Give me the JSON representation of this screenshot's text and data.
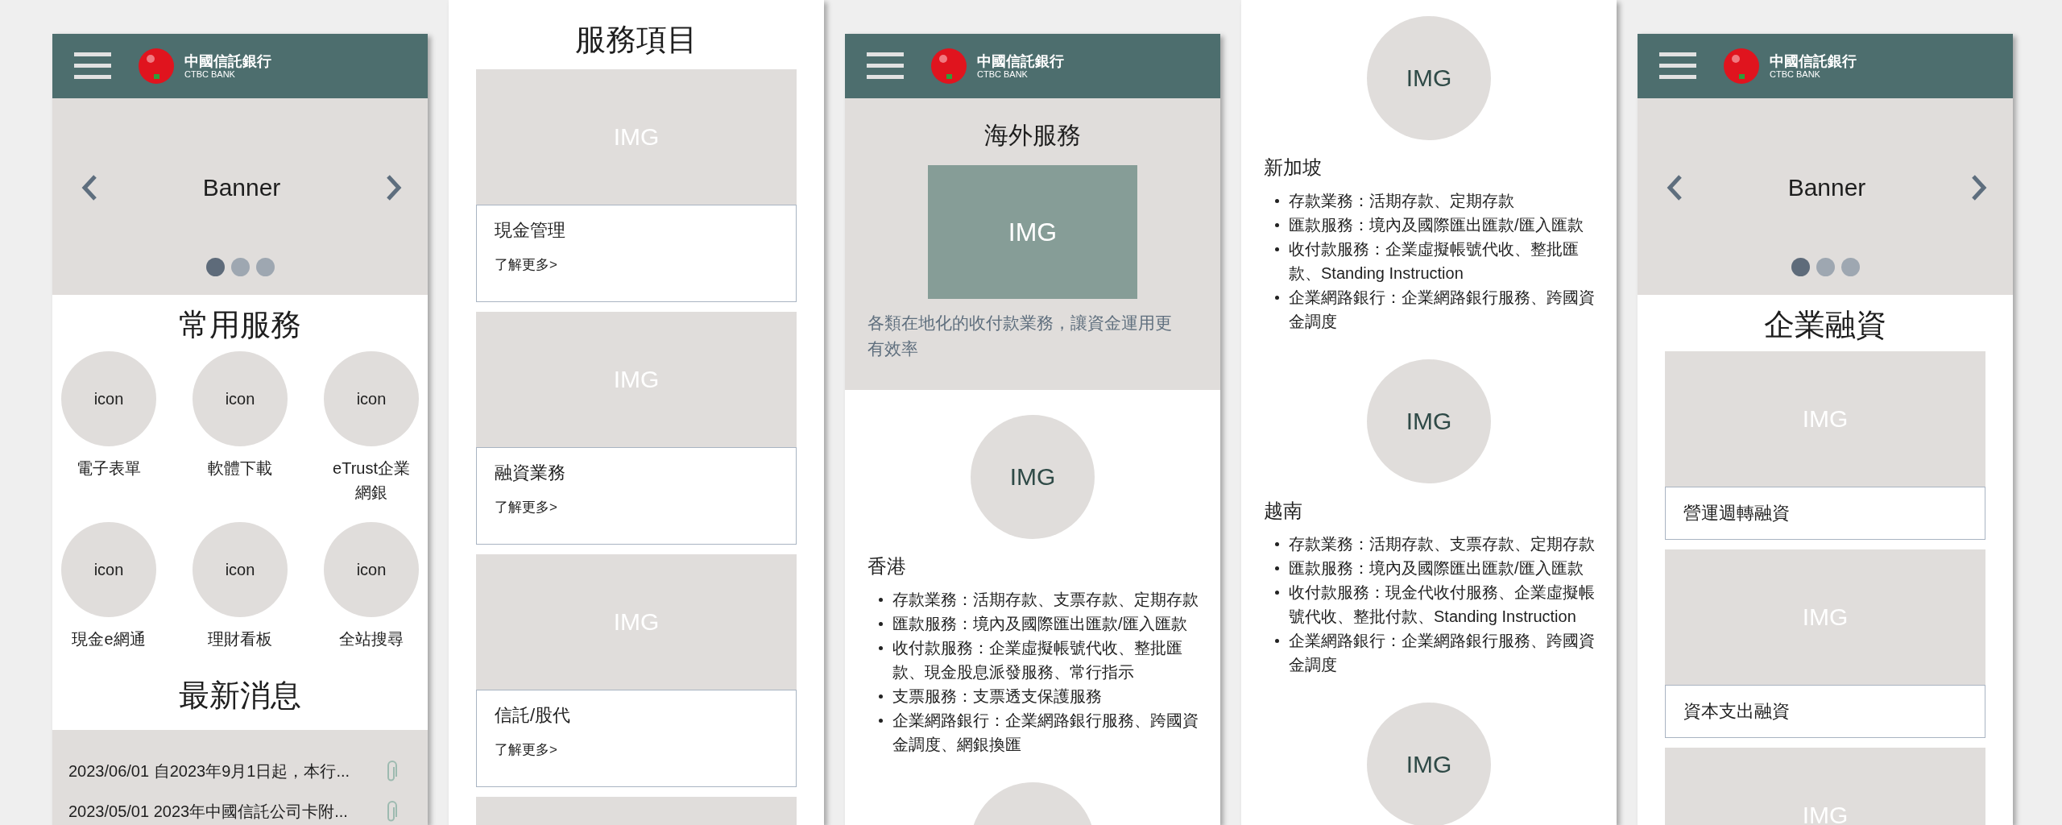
{
  "screens": [
    {
      "sections": [
        {
          "kind": "header",
          "bank_name": "中國信託銀行",
          "bank_name_en": "CTBC BANK"
        },
        {
          "kind": "banner",
          "label": "Banner",
          "dots": [
            {
              "selected": true
            },
            {
              "selected": false
            },
            {
              "selected": false
            }
          ]
        },
        {
          "kind": "title",
          "text": "常用服務"
        },
        {
          "kind": "services",
          "items": [
            {
              "icon": "icon",
              "label": "電子表單"
            },
            {
              "icon": "icon",
              "label": "軟體下載"
            },
            {
              "icon": "icon",
              "label": "eTrust企業網銀"
            },
            {
              "icon": "icon",
              "label": "現金e網通"
            },
            {
              "icon": "icon",
              "label": "理財看板"
            },
            {
              "icon": "icon",
              "label": "全站搜尋"
            }
          ]
        },
        {
          "kind": "title",
          "text": "最新消息"
        },
        {
          "kind": "news",
          "items": [
            "2023/06/01 自2023年9月1日起，本行...",
            "2023/05/01 2023年中國信託公司卡附..."
          ]
        }
      ]
    },
    {
      "sections": [
        {
          "kind": "title",
          "text": "服務項目"
        },
        {
          "kind": "cards",
          "items": [
            {
              "kind": "card",
              "img": "IMG",
              "title": "現金管理",
              "link": "了解更多>"
            },
            {
              "kind": "card",
              "img": "IMG",
              "title": "融資業務",
              "link": "了解更多>"
            },
            {
              "kind": "card",
              "img": "IMG",
              "title": "信託/股代",
              "link": "了解更多>"
            },
            {
              "kind": "picture"
            }
          ]
        }
      ]
    },
    {
      "sections": [
        {
          "kind": "header",
          "bank_name": "中國信託銀行",
          "bank_name_en": "CTBC BANK"
        },
        {
          "kind": "hero",
          "title": "海外服務",
          "img": "IMG",
          "description": "各類在地化的收付款業務，讓資金運用更有效率"
        },
        {
          "kind": "regions",
          "items": [
            {
              "kind": "region",
              "img": "IMG",
              "name": "香港",
              "bullets": [
                "存款業務：活期存款、支票存款、定期存款",
                "匯款服務：境內及國際匯出匯款/匯入匯款",
                "收付款服務：企業虛擬帳號代收、整批匯款、現金股息派發服務、常行指示",
                "支票服務：支票透支保護服務",
                "企業網路銀行：企業網路銀行服務、跨國資金調度、網銀換匯"
              ]
            },
            {
              "kind": "picture"
            }
          ]
        }
      ]
    },
    {
      "sections": [
        {
          "kind": "regions",
          "items": [
            {
              "kind": "region",
              "img": "IMG",
              "name": "新加坡",
              "bullets": [
                "存款業務：活期存款、定期存款",
                "匯款服務：境內及國際匯出匯款/匯入匯款",
                "收付款服務：企業虛擬帳號代收、整批匯款、Standing Instruction",
                "企業網路銀行：企業網路銀行服務、跨國資金調度"
              ]
            },
            {
              "kind": "region",
              "img": "IMG",
              "name": "越南",
              "bullets": [
                "存款業務：活期存款、支票存款、定期存款",
                "匯款服務：境內及國際匯出匯款/匯入匯款",
                "收付款服務：現金代收付服務、企業虛擬帳號代收、整批付款、Standing Instruction",
                "企業網路銀行：企業網路銀行服務、跨國資金調度"
              ]
            },
            {
              "kind": "image_only",
              "img": "IMG"
            }
          ]
        }
      ]
    },
    {
      "sections": [
        {
          "kind": "header",
          "bank_name": "中國信託銀行",
          "bank_name_en": "CTBC BANK"
        },
        {
          "kind": "banner",
          "label": "Banner",
          "dots": [
            {
              "selected": true
            },
            {
              "selected": false
            },
            {
              "selected": false
            }
          ]
        },
        {
          "kind": "title",
          "text": "企業融資"
        },
        {
          "kind": "cards",
          "items": [
            {
              "kind": "card",
              "img": "IMG",
              "title": "營運週轉融資"
            },
            {
              "kind": "card",
              "img": "IMG",
              "title": "資本支出融資"
            },
            {
              "kind": "image_only",
              "img": "IMG"
            }
          ]
        }
      ]
    }
  ]
}
